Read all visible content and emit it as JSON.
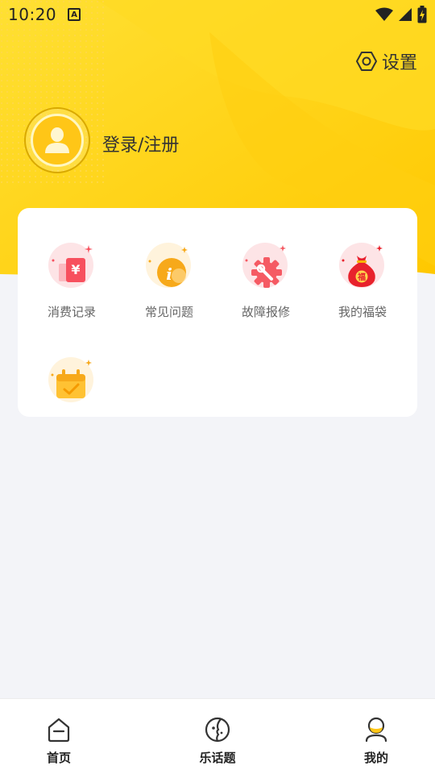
{
  "status_bar": {
    "time": "10:20",
    "notification_letter": "A"
  },
  "header": {
    "settings_label": "设置",
    "login_label": "登录/注册"
  },
  "menu": {
    "items": [
      {
        "label": "消费记录",
        "icon": "consumption-record-icon"
      },
      {
        "label": "常见问题",
        "icon": "faq-icon"
      },
      {
        "label": "故障报修",
        "icon": "repair-icon"
      },
      {
        "label": "我的福袋",
        "icon": "lucky-bag-icon"
      },
      {
        "label": "",
        "icon": "calendar-check-icon"
      }
    ]
  },
  "bottom_nav": {
    "items": [
      {
        "label": "首页",
        "icon": "home-icon"
      },
      {
        "label": "乐话题",
        "icon": "topic-icon"
      },
      {
        "label": "我的",
        "icon": "profile-icon"
      }
    ],
    "active_index": 2
  },
  "colors": {
    "brand_yellow": "#ffd21a",
    "page_bg": "#f3f4f8"
  }
}
